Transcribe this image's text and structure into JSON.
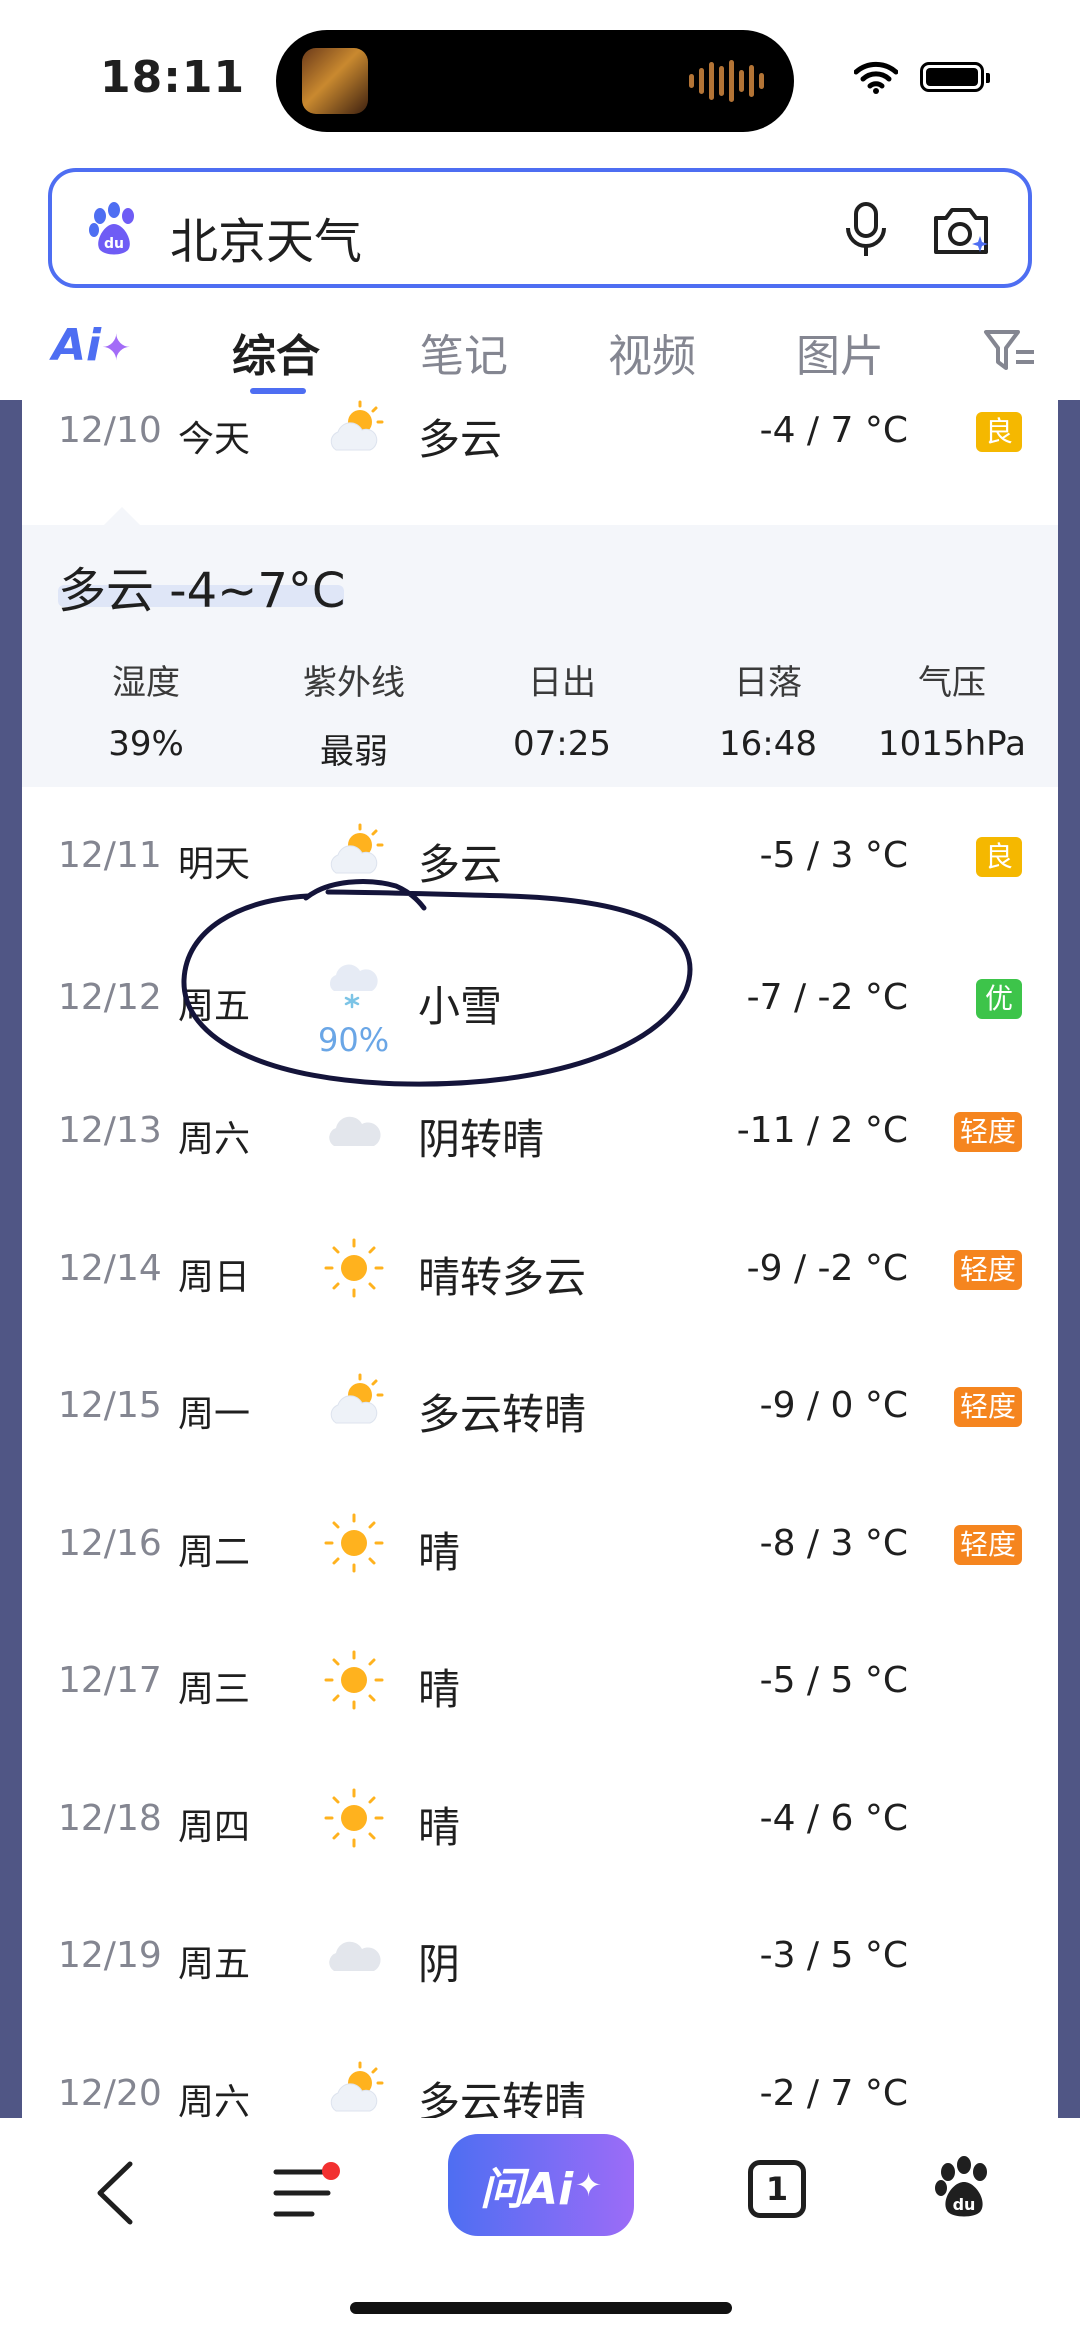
{
  "status_bar": {
    "time": "18:11"
  },
  "search": {
    "query": "北京天气"
  },
  "tabs": {
    "ai_label": "Ai",
    "items": [
      {
        "label": "综合",
        "active": true
      },
      {
        "label": "笔记",
        "active": false
      },
      {
        "label": "视频",
        "active": false
      },
      {
        "label": "图片",
        "active": false
      }
    ]
  },
  "today": {
    "date": "12/10",
    "day": "今天",
    "icon": "partly-cloudy-icon",
    "condition": "多云",
    "temp": "-4 / 7 °C",
    "aqi": "良"
  },
  "detail": {
    "headline": "多云 -4~7°C",
    "metrics": [
      {
        "label": "湿度",
        "value": "39%"
      },
      {
        "label": "紫外线",
        "value": "最弱"
      },
      {
        "label": "日出",
        "value": "07:25"
      },
      {
        "label": "日落",
        "value": "16:48"
      },
      {
        "label": "气压",
        "value": "1015hPa"
      }
    ]
  },
  "forecast": [
    {
      "date": "12/11",
      "day": "明天",
      "icon": "partly-cloudy-icon",
      "condition": "多云",
      "temp": "-5 / 3 °C",
      "aqi": "良",
      "aqi_level": "good"
    },
    {
      "date": "12/12",
      "day": "周五",
      "icon": "light-snow-icon",
      "condition": "小雪",
      "temp": "-7 / -2 °C",
      "aqi": "优",
      "aqi_level": "excellent",
      "precip": "90%"
    },
    {
      "date": "12/13",
      "day": "周六",
      "icon": "overcast-icon",
      "condition": "阴转晴",
      "temp": "-11 / 2 °C",
      "aqi": "轻度",
      "aqi_level": "light"
    },
    {
      "date": "12/14",
      "day": "周日",
      "icon": "sunny-icon",
      "condition": "晴转多云",
      "temp": "-9 / -2 °C",
      "aqi": "轻度",
      "aqi_level": "light"
    },
    {
      "date": "12/15",
      "day": "周一",
      "icon": "partly-cloudy-icon",
      "condition": "多云转晴",
      "temp": "-9 / 0 °C",
      "aqi": "轻度",
      "aqi_level": "light"
    },
    {
      "date": "12/16",
      "day": "周二",
      "icon": "sunny-icon",
      "condition": "晴",
      "temp": "-8 / 3 °C",
      "aqi": "轻度",
      "aqi_level": "light"
    },
    {
      "date": "12/17",
      "day": "周三",
      "icon": "sunny-icon",
      "condition": "晴",
      "temp": "-5 / 5 °C",
      "aqi": "",
      "aqi_level": ""
    },
    {
      "date": "12/18",
      "day": "周四",
      "icon": "sunny-icon",
      "condition": "晴",
      "temp": "-4 / 6 °C",
      "aqi": "",
      "aqi_level": ""
    },
    {
      "date": "12/19",
      "day": "周五",
      "icon": "overcast-icon",
      "condition": "阴",
      "temp": "-3 / 5 °C",
      "aqi": "",
      "aqi_level": ""
    },
    {
      "date": "12/20",
      "day": "周六",
      "icon": "partly-cloudy-icon",
      "condition": "多云转晴",
      "temp": "-2 / 7 °C",
      "aqi": "",
      "aqi_level": ""
    }
  ],
  "bottom_bar": {
    "ai_button": "问Ai",
    "tab_count": "1"
  },
  "colors": {
    "accent": "#4e6ef2",
    "aqi_good": "#f5b800",
    "aqi_excellent": "#3dc44a",
    "aqi_light": "#f5851f",
    "side_band": "#505685"
  }
}
